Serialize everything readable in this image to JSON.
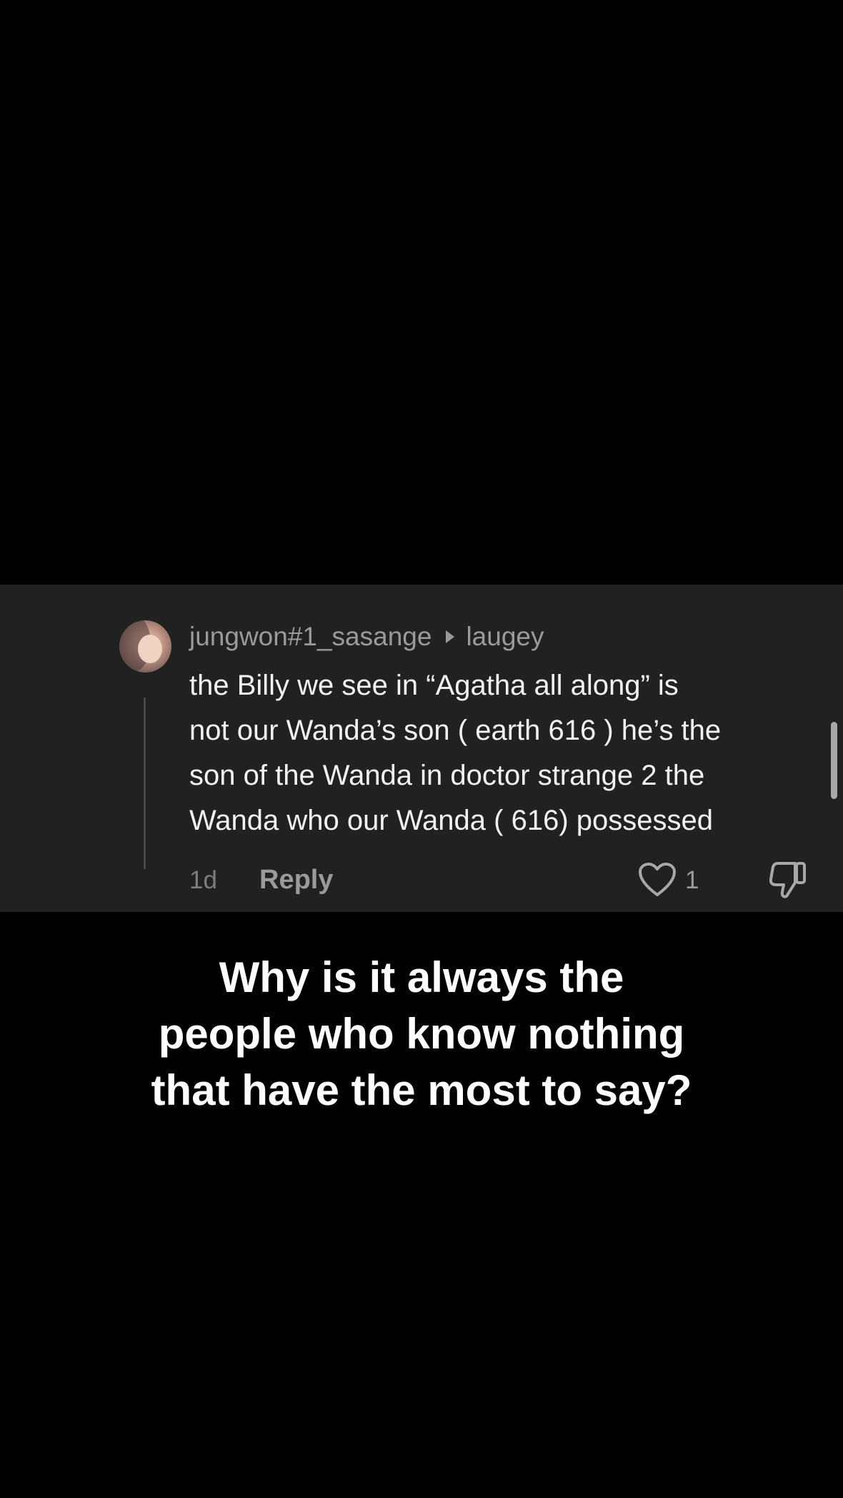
{
  "comment": {
    "username": "jungwon#1_sasange",
    "reply_to": "laugey",
    "text_lines": [
      "the Billy we see in “Agatha all along” is",
      "not our Wanda’s son ( earth 616 ) he’s the",
      "son of the Wanda in doctor strange 2 the",
      "Wanda who our Wanda ( 616) possessed"
    ],
    "time": "1d",
    "reply_label": "Reply",
    "like_count": "1",
    "icons": {
      "like": "heart-icon",
      "dislike": "thumbs-down-icon",
      "reply_to_marker": "triangle-right-icon"
    }
  },
  "caption": {
    "lines": [
      "Why is it always the",
      "people who know nothing",
      "that have the most to say?"
    ]
  },
  "colors": {
    "background": "#000000",
    "panel": "#212121",
    "muted_text": "#9a9a9a",
    "body_text": "#f2f2f2"
  }
}
